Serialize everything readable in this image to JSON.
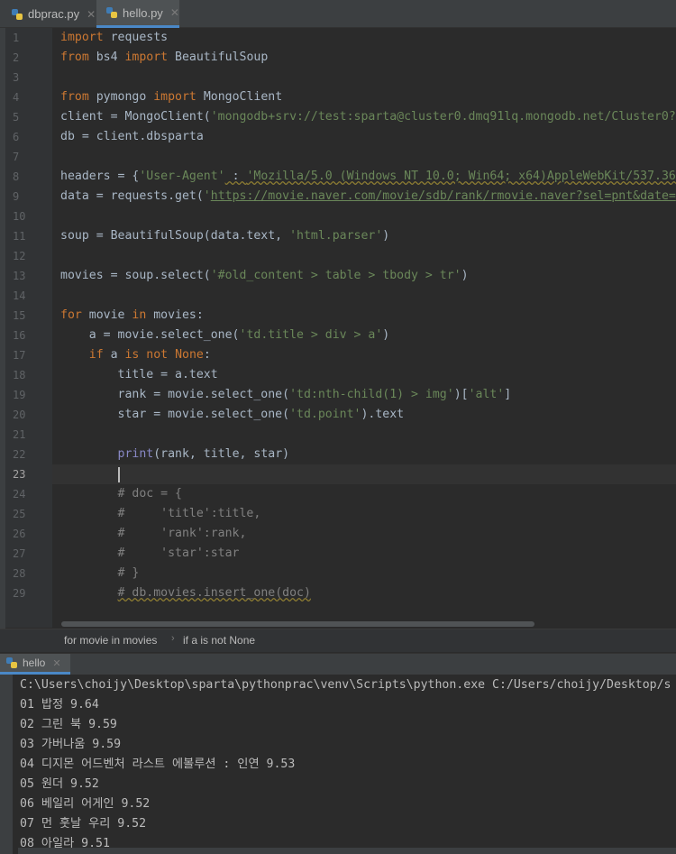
{
  "tabs": [
    {
      "label": "dbprac.py",
      "active": false,
      "icon": "python-file-icon"
    },
    {
      "label": "hello.py",
      "active": true,
      "icon": "python-file-icon"
    }
  ],
  "editor": {
    "line_numbers": [
      "1",
      "2",
      "3",
      "4",
      "5",
      "6",
      "7",
      "8",
      "9",
      "10",
      "11",
      "12",
      "13",
      "14",
      "15",
      "16",
      "17",
      "18",
      "19",
      "20",
      "21",
      "22",
      "23",
      "24",
      "25",
      "26",
      "27",
      "28",
      "29"
    ],
    "current_line": "23"
  },
  "code": {
    "l1_kw": "import",
    "l1_rest": " requests",
    "l2_kw1": "from",
    "l2_mid": " bs4 ",
    "l2_kw2": "import",
    "l2_rest": " BeautifulSoup",
    "l4_kw1": "from",
    "l4_mid": " pymongo ",
    "l4_kw2": "import",
    "l4_rest": " MongoClient",
    "l5_pre": "client = MongoClient(",
    "l5_str": "'mongodb+srv://test:sparta@cluster0.dmq91lq.mongodb.net/Cluster0?",
    "l6": "db = client.dbsparta",
    "l8_pre": "headers = {",
    "l8_str1": "'User-Agent'",
    "l8_mid": " : ",
    "l8_str2": "'Mozilla/5.0 (Windows NT 10.0; Win64; x64)AppleWebKit/537.36",
    "l9_pre": "data = requests.get(",
    "l9_q": "'",
    "l9_url": "https://movie.naver.com/movie/sdb/rank/rmovie.naver?sel=pnt&date=",
    "l11_pre": "soup = BeautifulSoup(data.text, ",
    "l11_str": "'html.parser'",
    "l11_post": ")",
    "l13_pre": "movies = soup.select(",
    "l13_str": "'#old_content > table > tbody > tr'",
    "l13_post": ")",
    "l15_kw1": "for",
    "l15_mid": " movie ",
    "l15_kw2": "in",
    "l15_rest": " movies:",
    "l16_pre": "    a = movie.select_one(",
    "l16_str": "'td.title > div > a'",
    "l16_post": ")",
    "l17_indent": "    ",
    "l17_kw1": "if",
    "l17_mid": " a ",
    "l17_kw2": "is not",
    "l17_sp": " ",
    "l17_kw3": "None",
    "l17_post": ":",
    "l18": "        title = a.text",
    "l19_pre": "        rank = movie.select_one(",
    "l19_str": "'td:nth-child(1) > img'",
    "l19_mid": ")[",
    "l19_str2": "'alt'",
    "l19_post": "]",
    "l20_pre": "        star = movie.select_one(",
    "l20_str": "'td.point'",
    "l20_post": ").text",
    "l22_indent": "        ",
    "l22_bi": "print",
    "l22_post": "(rank, title, star)",
    "l24": "        # doc = {",
    "l25": "        #     'title':title,",
    "l26": "        #     'rank':rank,",
    "l27": "        #     'star':star",
    "l28": "        # }",
    "l29_indent": "        ",
    "l29": "# db.movies.insert_one(doc)"
  },
  "breadcrumb": {
    "item1": "for movie in movies",
    "separator": "›",
    "item2": "if a is not None"
  },
  "run": {
    "tab_label": "hello",
    "lines": [
      "C:\\Users\\choijy\\Desktop\\sparta\\pythonprac\\venv\\Scripts\\python.exe C:/Users/choijy/Desktop/s",
      "01 밥정 9.64",
      "02 그린 북 9.59",
      "03 가버나움 9.59",
      "04 디지몬 어드벤처 라스트 에볼루션 : 인연 9.53",
      "05 원더 9.52",
      "06 베일리 어게인 9.52",
      "07 먼 훗날 우리 9.52",
      "08 아일라 9.51"
    ]
  },
  "colors": {
    "keyword": "#cc7832",
    "string": "#6a8759",
    "comment": "#808080",
    "text": "#a9b7c6",
    "accent": "#4a88c7"
  }
}
